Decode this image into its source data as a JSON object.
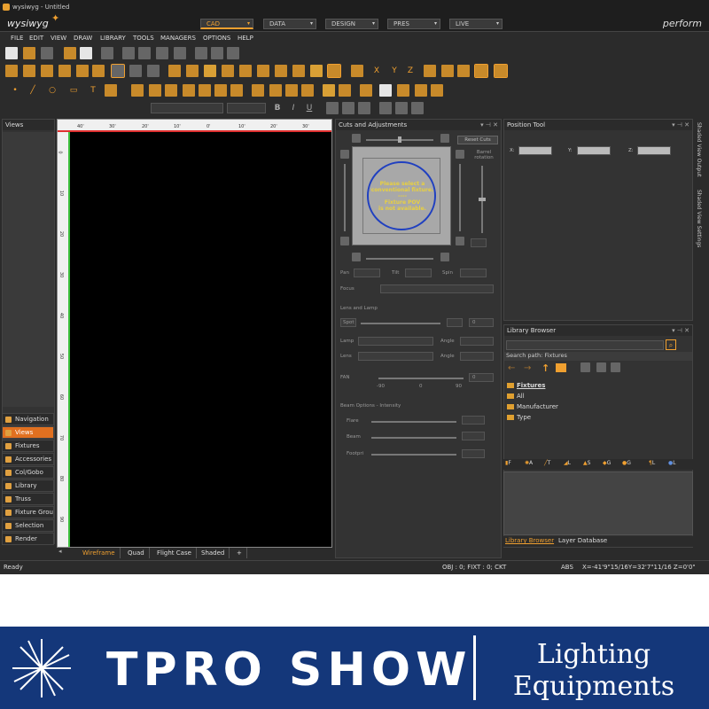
{
  "window": {
    "title": "wysiwyg - Untitled"
  },
  "modebar": {
    "logo": "wysiwyg",
    "modes": [
      {
        "label": "CAD",
        "active": true
      },
      {
        "label": "DATA",
        "active": false
      },
      {
        "label": "DESIGN",
        "active": false
      },
      {
        "label": "PRES",
        "active": false
      },
      {
        "label": "LIVE",
        "active": false
      }
    ],
    "perform": "perform"
  },
  "menubar": [
    "FILE",
    "EDIT",
    "VIEW",
    "DRAW",
    "LIBRARY",
    "TOOLS",
    "MANAGERS",
    "OPTIONS",
    "HELP"
  ],
  "format_bar": {
    "bold": "B",
    "italic": "I",
    "underline": "U"
  },
  "views_panel": {
    "title": "Views"
  },
  "nav_items": [
    {
      "label": "Navigation",
      "active": false
    },
    {
      "label": "Views",
      "active": true
    },
    {
      "label": "Fixtures",
      "active": false
    },
    {
      "label": "Accessories",
      "active": false
    },
    {
      "label": "Col/Gobo",
      "active": false
    },
    {
      "label": "Library",
      "active": false
    },
    {
      "label": "Truss",
      "active": false
    },
    {
      "label": "Fixture Grou",
      "active": false
    },
    {
      "label": "Selection Sets",
      "active": false
    },
    {
      "label": "Render",
      "active": false
    }
  ],
  "ruler": {
    "top": [
      "40'",
      "30'",
      "20'",
      "10'",
      "0'",
      "10'",
      "20'",
      "30'"
    ],
    "left": [
      "0",
      "10",
      "20",
      "30",
      "40",
      "50",
      "60",
      "70",
      "80",
      "90"
    ]
  },
  "viewport_tabs": [
    {
      "label": "Wireframe",
      "active": true
    },
    {
      "label": "Quad",
      "active": false
    },
    {
      "label": "Flight Case",
      "active": false
    },
    {
      "label": "Shaded",
      "active": false
    },
    {
      "label": "+",
      "active": false
    }
  ],
  "cuts": {
    "title": "Cuts and Adjustments",
    "reset": "Reset Cuts",
    "barrel": "Barrel rotation",
    "message": [
      "Please select a",
      "conventional fixture.",
      "----",
      "Fixture POV",
      "is not available."
    ],
    "pan": "Pan",
    "tilt": "Tilt",
    "spin": "Spin",
    "focus": "Focus",
    "lens_lamp": "Lens and Lamp",
    "spot": "Spot",
    "lamp": "Lamp",
    "lens": "Lens",
    "angle": "Angle",
    "fan": "FAN",
    "scale": [
      "-90",
      "0",
      "90"
    ],
    "beam_opts": "Beam Options - Intensity",
    "flare": "Flare",
    "beam": "Beam",
    "footpri": "Footpri",
    "zero": "0"
  },
  "position_tool": {
    "title": "Position Tool",
    "x": "X:",
    "y": "Y:",
    "z": "Z:"
  },
  "side_tabs": [
    "Shaded View Output",
    "Shaded View Settings"
  ],
  "library": {
    "title": "Library Browser",
    "search_path": "Search path: Fixtures",
    "tree": [
      {
        "label": "Fixtures",
        "level": 0
      },
      {
        "label": "All",
        "level": 1
      },
      {
        "label": "Manufacturer",
        "level": 1
      },
      {
        "label": "Type",
        "level": 1
      }
    ],
    "tabs": [
      "F",
      "A",
      "T",
      "L",
      "S",
      "G",
      "G",
      "L",
      "L"
    ],
    "bottom_tabs": [
      {
        "label": "Library Browser",
        "active": true
      },
      {
        "label": "Layer Database",
        "active": false
      }
    ]
  },
  "status": {
    "ready": "Ready",
    "counts": "OBJ : 0; FIXT : 0; CKT",
    "abs": "ABS",
    "coords": "X=-41'9\"15/16Y=32'7\"11/16  Z=0'0\""
  },
  "banner": {
    "brand": "TPRO SHOW",
    "line1": "Lighting",
    "line2": "Equipments",
    "bg_color": "#14377a"
  },
  "colors": {
    "accent": "#f0a030",
    "active_nav": "#e07020",
    "msg_text": "#e8d040",
    "circle": "#2040c0"
  }
}
